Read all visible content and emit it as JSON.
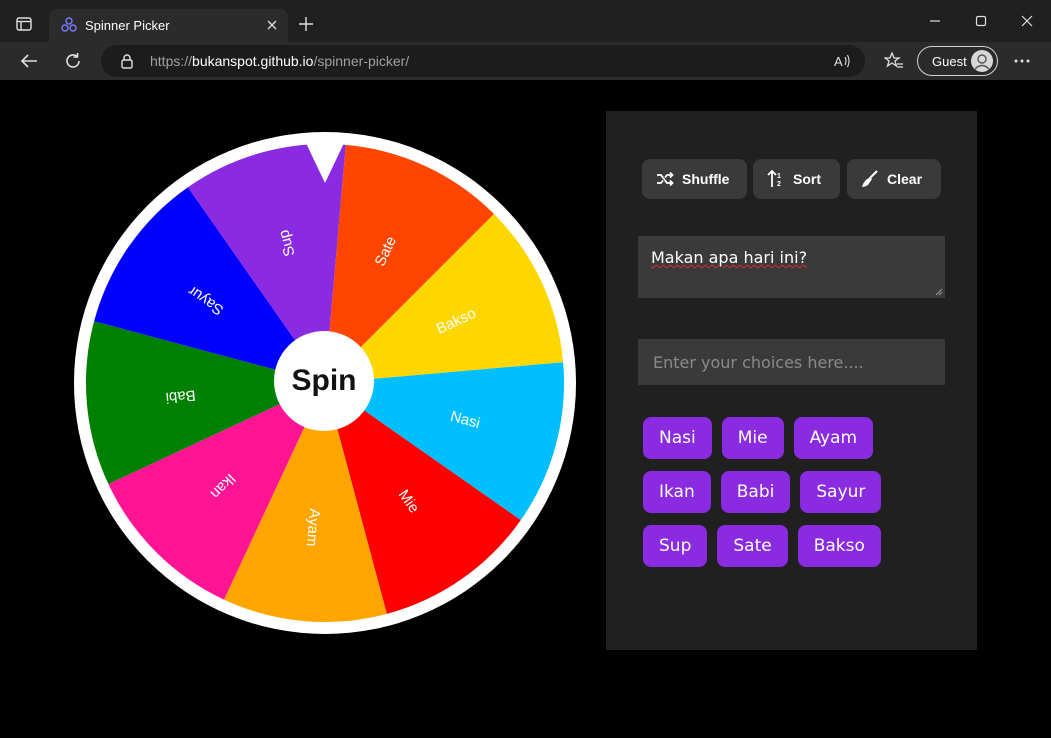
{
  "browser": {
    "tab_title": "Spinner Picker",
    "url_scheme": "https://",
    "url_host": "bukanspot.github.io",
    "url_path": "/spinner-picker/",
    "profile_label": "Guest"
  },
  "colors": {
    "accent_purple": "#8a2be2",
    "panel_bg": "#202020",
    "button_bg": "#3a3a3a"
  },
  "wheel": {
    "spin_label": "Spin",
    "segments": [
      {
        "label": "Nasi",
        "color": "#00bfff"
      },
      {
        "label": "Mie",
        "color": "#ff0000"
      },
      {
        "label": "Ayam",
        "color": "#ffa500"
      },
      {
        "label": "Ikan",
        "color": "#ff1493"
      },
      {
        "label": "Babi",
        "color": "#008000"
      },
      {
        "label": "Sayur",
        "color": "#0000ff"
      },
      {
        "label": "Sup",
        "color": "#8a2be2"
      },
      {
        "label": "Sate",
        "color": "#ff4500"
      },
      {
        "label": "Bakso",
        "color": "#ffd700"
      }
    ]
  },
  "controls": {
    "shuffle_label": "Shuffle",
    "sort_label": "Sort",
    "clear_label": "Clear",
    "title_value": "Makan apa hari ini?",
    "choices_placeholder": "Enter your choices here...."
  },
  "choices": [
    [
      "Nasi",
      "Mie",
      "Ayam"
    ],
    [
      "Ikan",
      "Babi",
      "Sayur"
    ],
    [
      "Sup",
      "Sate",
      "Bakso"
    ]
  ]
}
